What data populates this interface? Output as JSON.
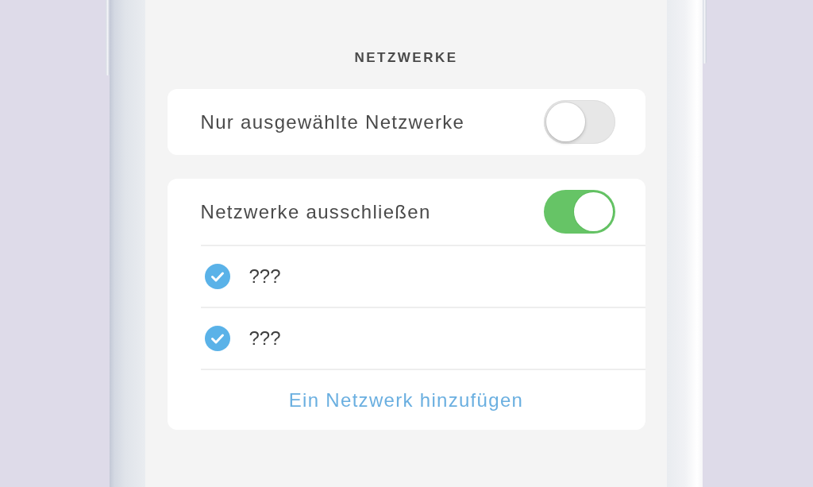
{
  "section_title": "NETZWERKE",
  "cards": [
    {
      "label": "Nur ausgewählte Netzwerke",
      "on": false
    },
    {
      "label": "Netzwerke ausschließen",
      "on": true,
      "networks": [
        {
          "name": "???",
          "checked": true
        },
        {
          "name": "???",
          "checked": true
        }
      ],
      "add_link": "Ein Netzwerk hinzufügen"
    }
  ]
}
